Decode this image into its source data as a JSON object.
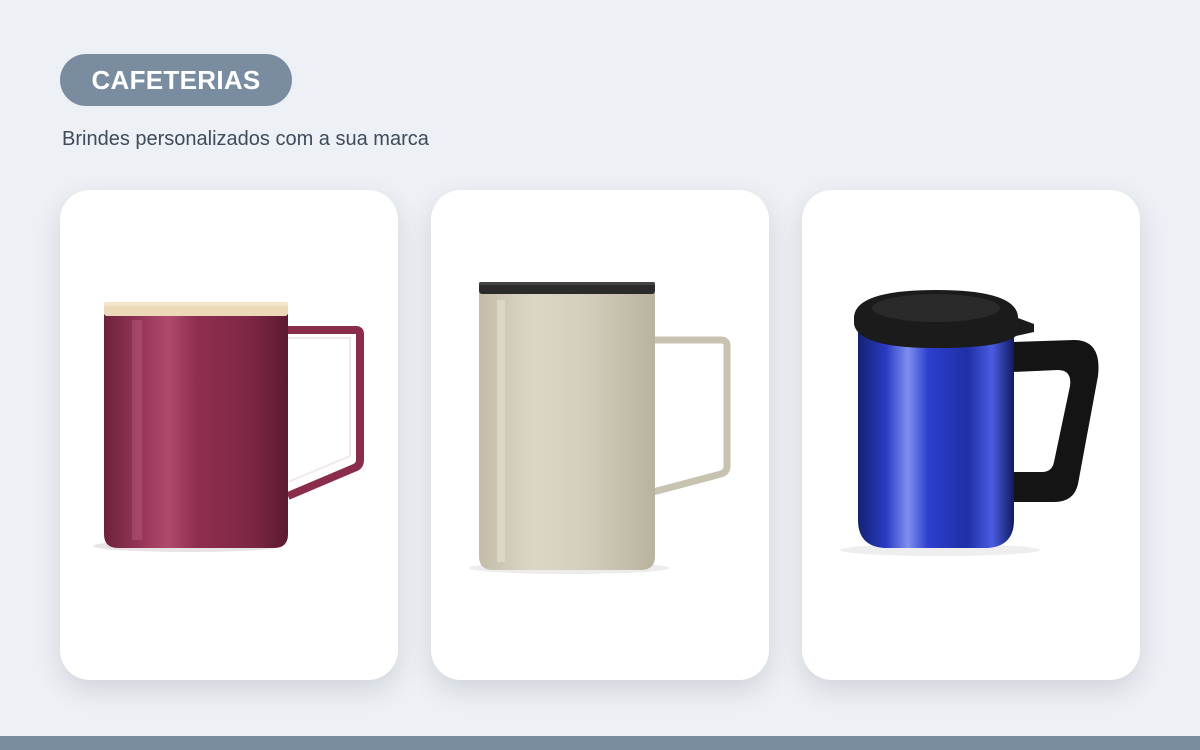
{
  "header": {
    "badge_label": "CAFETERIAS",
    "subtitle": "Brindes personalizados com a sua marca"
  },
  "products": [
    {
      "name": "mug-burgundy",
      "body_color": "#8c2f4c",
      "lid_color": "#ecd9b8"
    },
    {
      "name": "mug-beige",
      "body_color": "#d6d0bf",
      "lid_color": "#2b2b2b"
    },
    {
      "name": "mug-blue",
      "body_color": "#2435b8",
      "lid_color": "#1b1b1b"
    }
  ],
  "colors": {
    "accent": "#7a8da0",
    "background": "#edf0f4"
  }
}
